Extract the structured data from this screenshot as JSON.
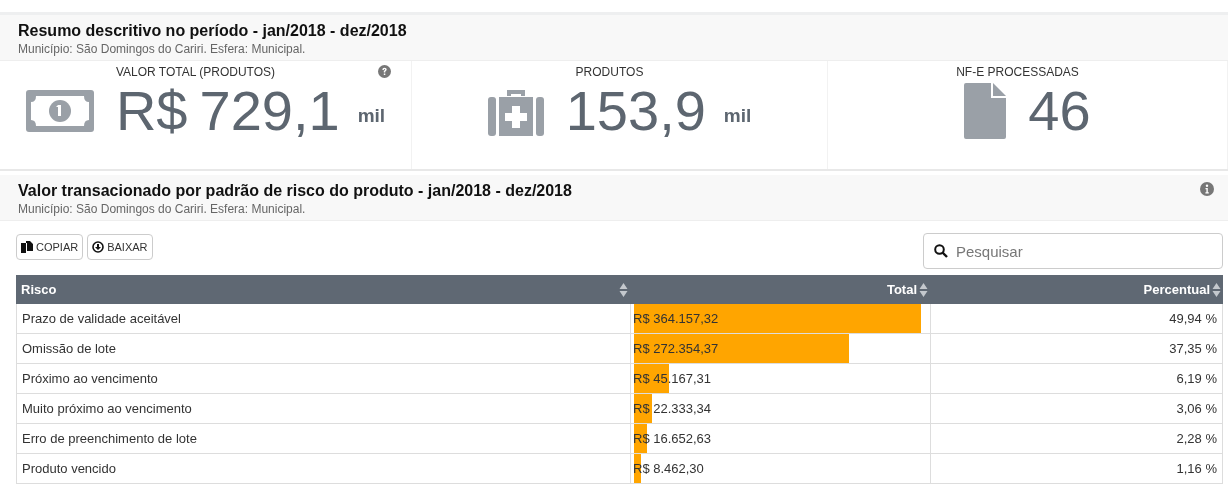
{
  "summary": {
    "title": "Resumo descritivo no período - jan/2018 - dez/2018",
    "subtitle": "Município: São Domingos do Cariri. Esfera: Municipal.",
    "stats": [
      {
        "kind": "money",
        "label": "VALOR TOTAL (PRODUTOS)",
        "prefix": "R$",
        "value": "729,1",
        "unit": "mil",
        "help": true
      },
      {
        "kind": "medkit",
        "label": "PRODUTOS",
        "value": "153,9",
        "unit": "mil",
        "help": false
      },
      {
        "kind": "file",
        "label": "NF-E PROCESSADAS",
        "value": "46",
        "help": false
      }
    ]
  },
  "risk": {
    "title": "Valor transacionado por padrão de risco do produto - jan/2018 - dez/2018",
    "subtitle": "Município: São Domingos do Cariri. Esfera: Municipal.",
    "buttons": [
      {
        "kind": "copy",
        "label": "COPIAR"
      },
      {
        "kind": "download",
        "label": "BAIXAR"
      }
    ],
    "search": {
      "placeholder": "Pesquisar"
    },
    "columns": [
      "Risco",
      "Total",
      "Percentual"
    ],
    "rows": [
      {
        "risco": "Prazo de validade aceitável",
        "total": "R$ 364.157,32",
        "level": 0.98,
        "percentual": "49,94 %"
      },
      {
        "risco": "Omissão de lote",
        "total": "R$ 272.354,37",
        "level": 0.735,
        "percentual": "37,35 %"
      },
      {
        "risco": "Próximo ao vencimento",
        "total": "R$ 45.167,31",
        "level": 0.12,
        "percentual": "6,19 %"
      },
      {
        "risco": "Muito próximo ao vencimento",
        "total": "R$ 22.333,34",
        "level": 0.06,
        "percentual": "3,06 %"
      },
      {
        "risco": "Erro de preenchimento de lote",
        "total": "R$ 16.652,63",
        "level": 0.045,
        "percentual": "2,28 %"
      },
      {
        "risco": "Produto vencido",
        "total": "R$ 8.462,30",
        "level": 0.023,
        "percentual": "1,16 %"
      }
    ]
  }
}
